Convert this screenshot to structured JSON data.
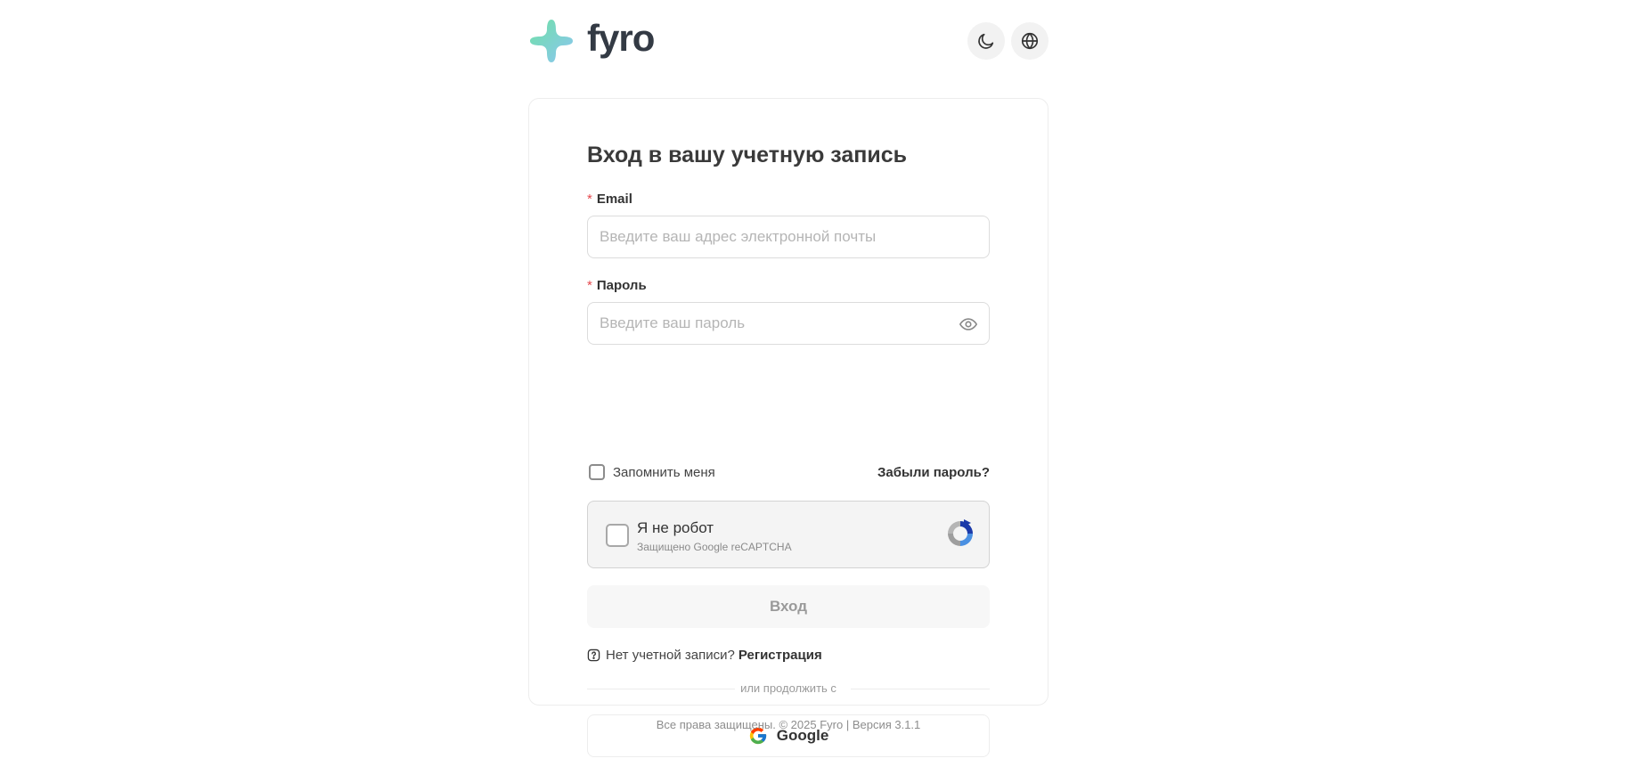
{
  "brand": {
    "name": "fyro"
  },
  "header": {
    "theme_icon": "moon-icon",
    "language_icon": "globe-icon"
  },
  "login": {
    "title": "Вход в вашу учетную запись",
    "email_label": "Email",
    "email_placeholder": "Введите ваш адрес электронной почты",
    "email_value": "",
    "password_label": "Пароль",
    "password_placeholder": "Введите ваш пароль",
    "password_value": "",
    "required_marker": "*",
    "remember_label": "Запомнить меня",
    "remember_checked": false,
    "forgot_label": "Забыли пароль?",
    "captcha_label": "Я не робот",
    "captcha_sub": "Защищено Google reCAPTCHA",
    "submit_label": "Вход",
    "no_account_text": "Нет учетной записи?",
    "register_label": "Регистрация",
    "divider_text": "или продолжить с",
    "google_label": "Google"
  },
  "footer": {
    "text": "Все права защищены. © 2025 Fyro | Версия 3.1.1"
  },
  "colors": {
    "brand_gradient_start": "#7de2a8",
    "brand_gradient_end": "#8fc9f0",
    "required": "#e5484d",
    "text": "#333333"
  }
}
